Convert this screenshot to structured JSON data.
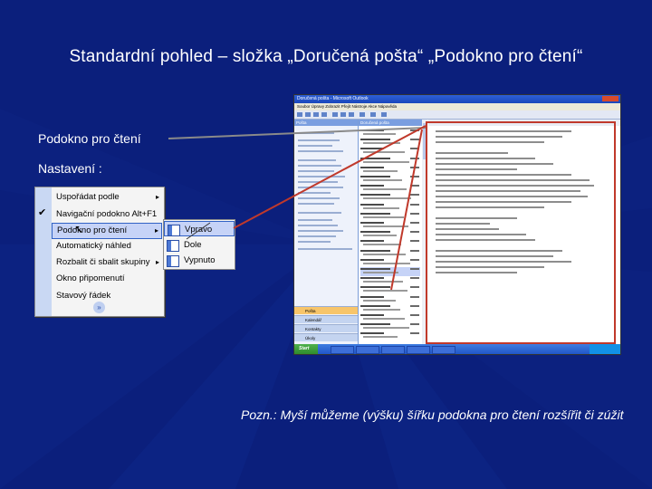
{
  "slide": {
    "title": "Standardní pohled – složka „Doručená pošta“ „Podokno pro čtení“",
    "label_reading_pane": "Podokno pro čtení",
    "label_settings": "Nastavení :",
    "note": "Pozn.: Myší můžeme (výšku) šířku podokna pro čtení rozšířit či zúžit"
  },
  "menu": {
    "items": [
      {
        "label": "Uspořádat podle",
        "arrow": "▸",
        "checked": false,
        "highlight": false
      },
      {
        "label": "Navigační podokno   Alt+F1",
        "arrow": "",
        "checked": true,
        "highlight": false
      },
      {
        "label": "Podokno pro čtení",
        "arrow": "▸",
        "checked": false,
        "highlight": true
      },
      {
        "label": "Automatický náhled",
        "arrow": "",
        "checked": false,
        "highlight": false
      },
      {
        "label": "Rozbalit či sbalit skupiny",
        "arrow": "▸",
        "checked": false,
        "highlight": false
      },
      {
        "label": "Okno připomenutí",
        "arrow": "",
        "checked": false,
        "highlight": false
      },
      {
        "label": "Stavový řádek",
        "arrow": "",
        "checked": false,
        "highlight": false
      }
    ],
    "check_glyph": "✔",
    "more_glyph": "»"
  },
  "submenu": {
    "items": [
      {
        "label": "Vpravo",
        "highlight": true
      },
      {
        "label": "Dole",
        "highlight": false
      },
      {
        "label": "Vypnuto",
        "highlight": false
      }
    ]
  },
  "outlook": {
    "window_title": "Doručená pošta - Microsoft Outlook",
    "menubar": "Soubor  Úpravy  Zobrazit  Přejít  Nástroje  Akce  Nápověda",
    "nav_header": "Pošta",
    "list_header": "Doručená pošta",
    "nav_buttons": [
      "Pošta",
      "Kalendář",
      "Kontakty",
      "Úkoly"
    ],
    "start_label": "Start"
  },
  "colors": {
    "background": "#0b1f7c",
    "connector": "#c0392b",
    "leader": "#8a8a8a"
  }
}
